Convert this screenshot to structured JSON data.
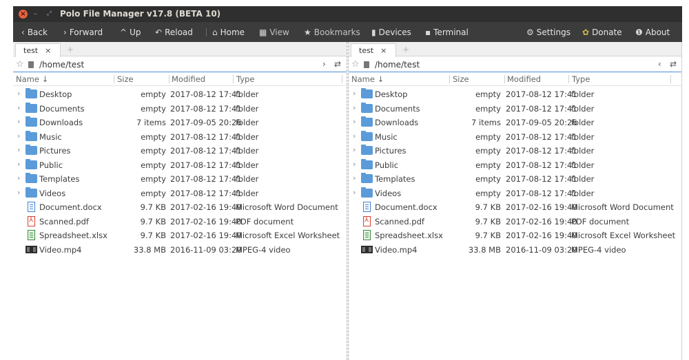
{
  "window": {
    "title": "Polo File Manager v17.8 (BETA 10)",
    "close_glyph": "×",
    "min_glyph": "–",
    "max_glyph": "⤢"
  },
  "toolbar": {
    "back": "Back",
    "forward": "Forward",
    "up": "Up",
    "reload": "Reload",
    "home": "Home",
    "view": "View",
    "bookmarks": "Bookmarks",
    "devices": "Devices",
    "terminal": "Terminal",
    "settings": "Settings",
    "donate": "Donate",
    "about": "About",
    "icons": {
      "back": "‹",
      "forward": "›",
      "up": "^",
      "reload": "↶",
      "home": "⌂",
      "view": "▦",
      "bookmarks": "★",
      "devices": "▮",
      "terminal": "▪",
      "settings": "⚙",
      "donate": "✿",
      "about": "❶"
    }
  },
  "panes": {
    "left": {
      "tab_label": "test",
      "tab_close": "×",
      "tab_add": "+",
      "path": "/home/test",
      "nav_glyph": "›",
      "swap_glyph": "⇄",
      "columns": {
        "name": "Name ↓",
        "size": "Size",
        "modified": "Modified",
        "type": "Type"
      }
    },
    "right": {
      "tab_label": "test",
      "tab_close": "×",
      "tab_add": "+",
      "path": "/home/test",
      "nav_glyph": "‹",
      "swap_glyph": "⇄",
      "columns": {
        "name": "Name ↓",
        "size": "Size",
        "modified": "Modified",
        "type": "Type"
      }
    }
  },
  "files": [
    {
      "name": "Desktop",
      "size": "empty",
      "modified": "2017-08-12 17:41",
      "type": "folder",
      "icon": "folder-icon",
      "expand": "›"
    },
    {
      "name": "Documents",
      "size": "empty",
      "modified": "2017-08-12 17:41",
      "type": "folder",
      "icon": "folder-icon",
      "expand": "›"
    },
    {
      "name": "Downloads",
      "size": "7 items",
      "modified": "2017-09-05 20:26",
      "type": "folder",
      "icon": "folder-icon",
      "expand": "›"
    },
    {
      "name": "Music",
      "size": "empty",
      "modified": "2017-08-12 17:41",
      "type": "folder",
      "icon": "folder-icon",
      "expand": "›"
    },
    {
      "name": "Pictures",
      "size": "empty",
      "modified": "2017-08-12 17:41",
      "type": "folder",
      "icon": "folder-icon",
      "expand": "›"
    },
    {
      "name": "Public",
      "size": "empty",
      "modified": "2017-08-12 17:41",
      "type": "folder",
      "icon": "folder-icon",
      "expand": "›"
    },
    {
      "name": "Templates",
      "size": "empty",
      "modified": "2017-08-12 17:41",
      "type": "folder",
      "icon": "folder-icon",
      "expand": "›"
    },
    {
      "name": "Videos",
      "size": "empty",
      "modified": "2017-08-12 17:41",
      "type": "folder",
      "icon": "folder-icon",
      "expand": "›"
    },
    {
      "name": "Document.docx",
      "size": "9.7 KB",
      "modified": "2017-02-16 19:40",
      "type": "Microsoft Word Document",
      "icon": "word-document-icon",
      "expand": ""
    },
    {
      "name": "Scanned.pdf",
      "size": "9.7 KB",
      "modified": "2017-02-16 19:40",
      "type": "PDF document",
      "icon": "pdf-document-icon",
      "expand": ""
    },
    {
      "name": "Spreadsheet.xlsx",
      "size": "9.7 KB",
      "modified": "2017-02-16 19:40",
      "type": "Microsoft Excel Worksheet",
      "icon": "spreadsheet-icon",
      "expand": ""
    },
    {
      "name": "Video.mp4",
      "size": "33.8 MB",
      "modified": "2016-11-09 03:20",
      "type": "MPEG-4 video",
      "icon": "video-file-icon",
      "expand": ""
    }
  ],
  "colors": {
    "titlebar": "#2f2f2f",
    "toolbar": "#3c3c3c",
    "close_button": "#e9603d",
    "folder": "#5b9bd9",
    "path_underline": "#4a90d9"
  }
}
